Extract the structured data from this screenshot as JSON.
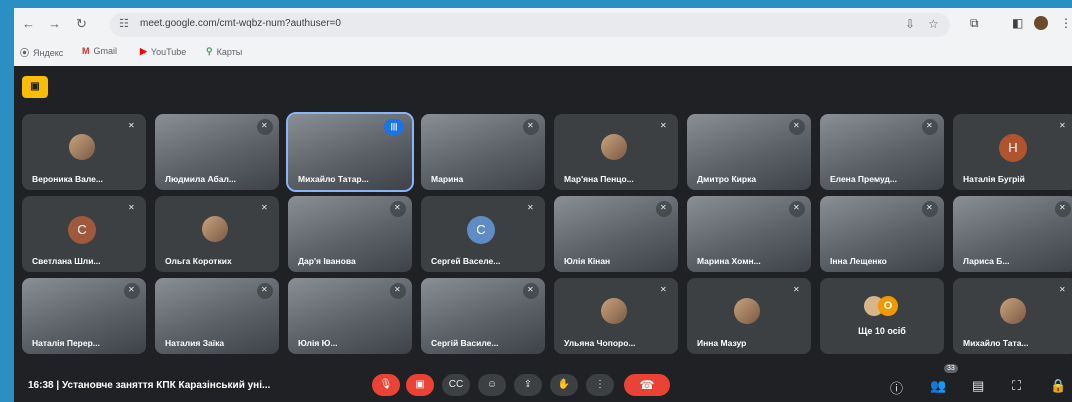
{
  "browser": {
    "url": "meet.google.com/cmt-wqbz-num?authuser=0",
    "bookmarks": [
      "Яндекс",
      "Gmail",
      "YouTube",
      "Карты"
    ]
  },
  "participants": [
    {
      "name": "Вероника Вале...",
      "style": "photo"
    },
    {
      "name": "Людмила Абал...",
      "style": "video"
    },
    {
      "name": "Михайло Татар...",
      "style": "video"
    },
    {
      "name": "Марина",
      "style": "video"
    },
    {
      "name": "Мар'яна Пенцо...",
      "style": "photo"
    },
    {
      "name": "Дмитро Кирка",
      "style": "video"
    },
    {
      "name": "Елена Премуд...",
      "style": "video"
    },
    {
      "name": "Наталія Бугрій",
      "style": "letter",
      "letter": "Н",
      "color": "#b0542f"
    },
    {
      "name": "Светлана Шли...",
      "style": "letter",
      "letter": "С",
      "color": "#a0593c"
    },
    {
      "name": "Ольга Коротких",
      "style": "photo"
    },
    {
      "name": "Дар'я Іванова",
      "style": "video"
    },
    {
      "name": "Сергей Васеле...",
      "style": "letter",
      "letter": "С",
      "color": "#5f8cc4"
    },
    {
      "name": "Юлія Кінан",
      "style": "video"
    },
    {
      "name": "Марина Хомн...",
      "style": "video"
    },
    {
      "name": "Інна Лещенко",
      "style": "video"
    },
    {
      "name": "Лариса Б...",
      "style": "video"
    },
    {
      "name": "Наталія Перер...",
      "style": "video"
    },
    {
      "name": "Наталия Заїка",
      "style": "video"
    },
    {
      "name": "Юлія Ю...",
      "style": "video"
    },
    {
      "name": "Сергій Василе...",
      "style": "video"
    },
    {
      "name": "Ульяна Чопоро...",
      "style": "photo"
    },
    {
      "name": "Инна Мазур",
      "style": "photo"
    },
    {
      "name": "Ще 10 осіб",
      "style": "more",
      "count_letter": "О"
    },
    {
      "name": "Михайло Тата...",
      "style": "photo"
    }
  ],
  "controls": {
    "time": "16:38",
    "meeting_title": "Установче заняття КПК Каразінський уні...",
    "people_count": "33"
  }
}
